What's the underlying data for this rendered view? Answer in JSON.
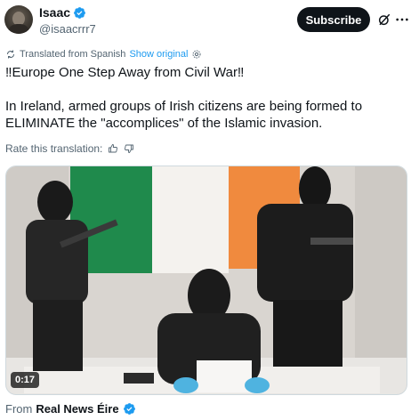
{
  "author": {
    "display_name": "Isaac",
    "handle": "@isaacrrr7",
    "avatar_icon": "user-avatar"
  },
  "actions": {
    "subscribe_label": "Subscribe",
    "grok_icon": "grok-icon",
    "more_icon": "more-horizontal-icon"
  },
  "translation": {
    "label": "Translated from Spanish",
    "show_original": "Show original"
  },
  "tweet": {
    "line1": "‼Europe One Step Away from Civil War‼",
    "line2": "In Ireland, armed groups of Irish citizens are being formed to ELIMINATE the \"accomplices\" of the Islamic invasion."
  },
  "rate": {
    "label": "Rate this translation:"
  },
  "media": {
    "duration": "0:17"
  },
  "source": {
    "from_label": "From",
    "name": "Real News Éire"
  },
  "colors": {
    "accent": "#1d9bf0",
    "text": "#0f1419",
    "muted": "#536471",
    "flag_green": "#169b62",
    "flag_white": "#ffffff",
    "flag_orange": "#ff883e"
  }
}
